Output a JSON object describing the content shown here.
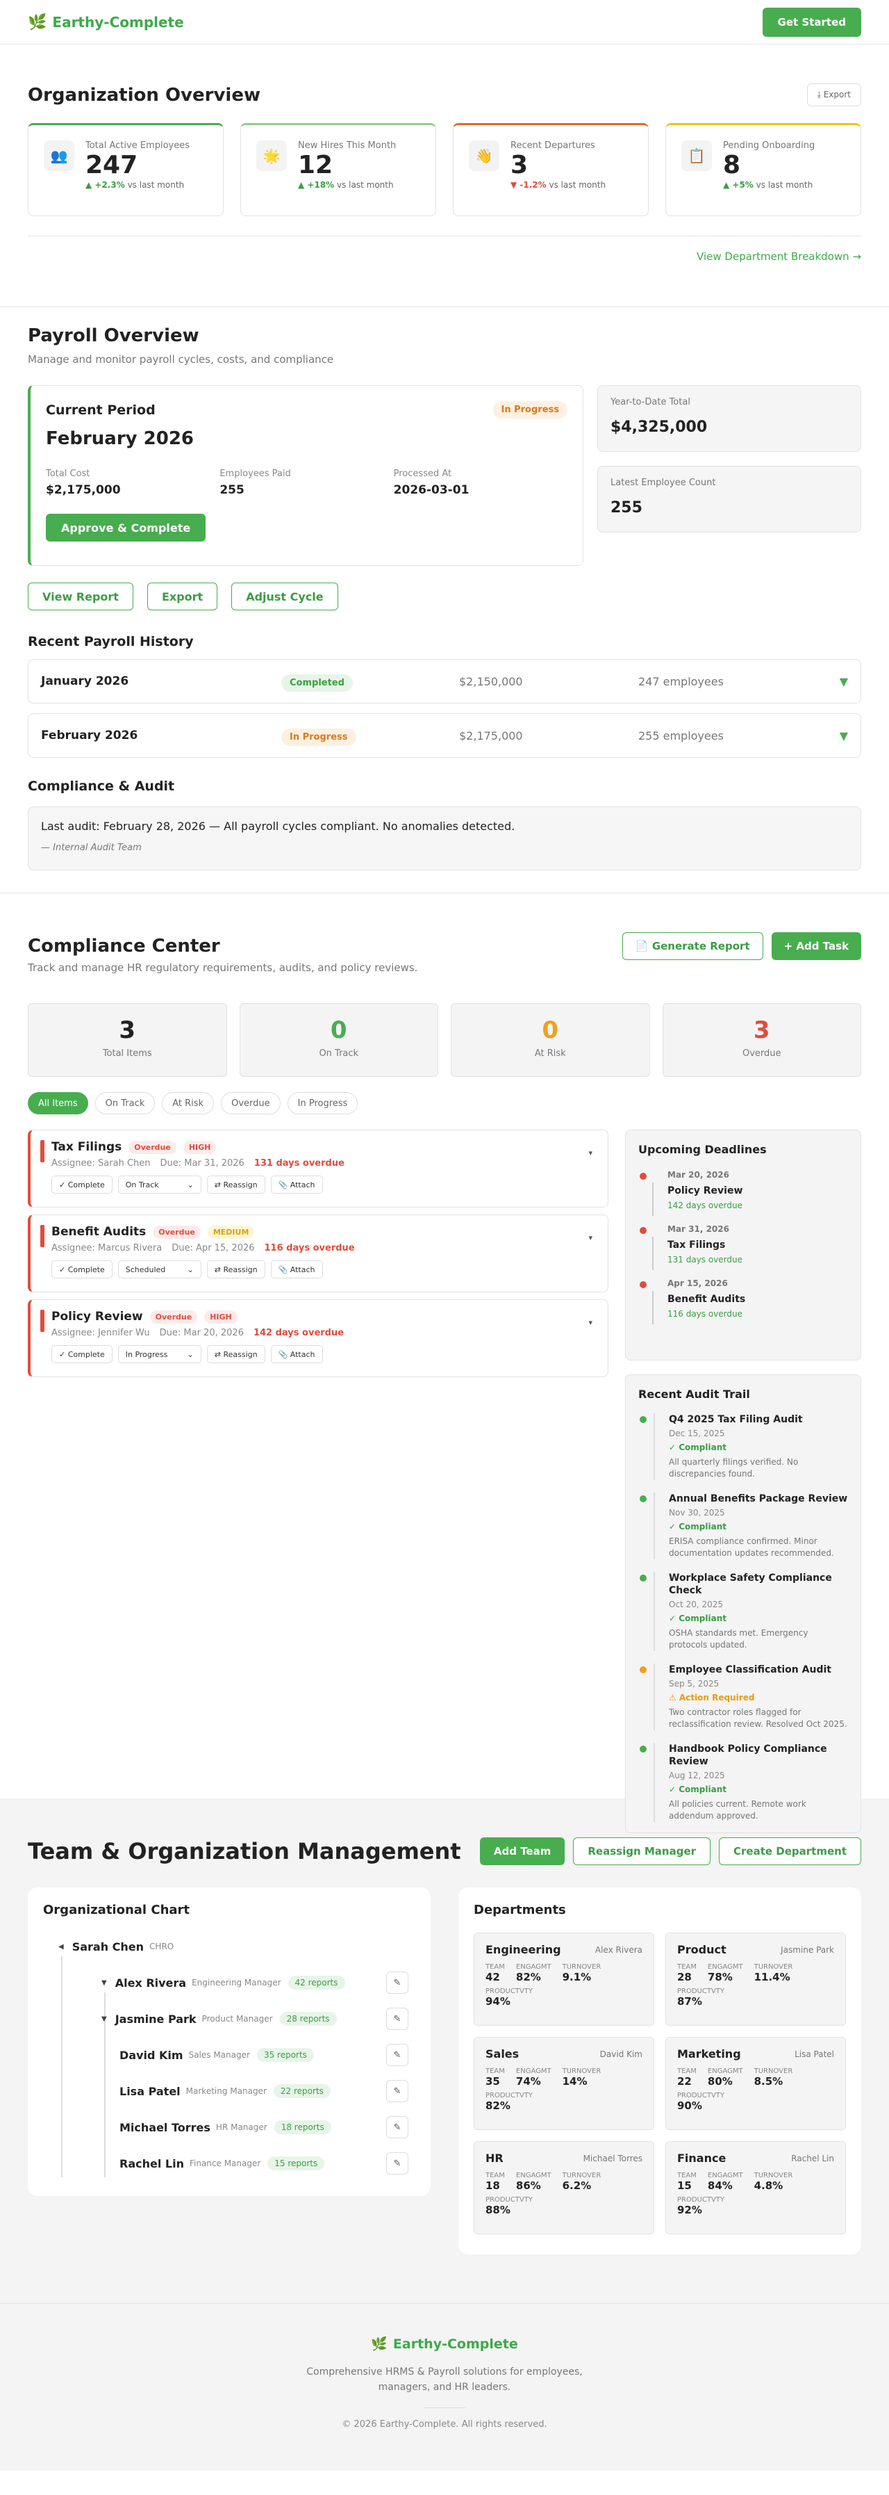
{
  "brand": {
    "name": "Earthy-Complete",
    "cta": "Get Started"
  },
  "org": {
    "title": "Organization Overview",
    "export": "Export",
    "link": "View Department Breakdown →",
    "stats": [
      {
        "label": "Total Active Employees",
        "value": "247",
        "change": "▲ +2.3%",
        "suffix": "vs last month",
        "dir": "up",
        "icon": "people-icon",
        "glyph": "👥",
        "accent": "#48ad4f"
      },
      {
        "label": "New Hires This Month",
        "value": "12",
        "change": "▲ +18%",
        "suffix": "vs last month",
        "dir": "up",
        "icon": "sparkle-icon",
        "glyph": "🌟",
        "accent": "#8fcf8f"
      },
      {
        "label": "Recent Departures",
        "value": "3",
        "change": "▼ -1.2%",
        "suffix": "vs last month",
        "dir": "down",
        "icon": "wave-icon",
        "glyph": "👋",
        "accent": "#e8672a"
      },
      {
        "label": "Pending Onboarding",
        "value": "8",
        "change": "▲ +5%",
        "suffix": "vs last month",
        "dir": "up",
        "icon": "clipboard-icon",
        "glyph": "📋",
        "accent": "#f2c418"
      }
    ]
  },
  "payroll": {
    "title": "Payroll Overview",
    "subtitle": "Manage and monitor payroll cycles, costs, and compliance",
    "current": {
      "heading": "Current Period",
      "status": "In Progress",
      "month": "February 2026",
      "cost_label": "Total Cost",
      "cost": "$2,175,000",
      "paid_label": "Employees Paid",
      "paid": "255",
      "proc_label": "Processed At",
      "proc": "2026-03-01",
      "approve": "Approve & Complete"
    },
    "ytd_label": "Year-to-Date Total",
    "ytd": "$4,325,000",
    "count_label": "Latest Employee Count",
    "count": "255",
    "buttons": {
      "report": "View Report",
      "export": "Export",
      "adjust": "Adjust Cycle"
    },
    "history_title": "Recent Payroll History",
    "history": [
      {
        "month": "January 2026",
        "status": "Completed",
        "amount": "$2,150,000",
        "employees": "247 employees"
      },
      {
        "month": "February 2026",
        "status": "In Progress",
        "amount": "$2,175,000",
        "employees": "255 employees"
      }
    ],
    "audit_title": "Compliance & Audit",
    "audit_text": "Last audit: February 28, 2026 — All payroll cycles compliant. No anomalies detected.",
    "audit_by": "— Internal Audit Team"
  },
  "compliance": {
    "title": "Compliance Center",
    "subtitle": "Track and manage HR regulatory requirements, audits, and policy reviews.",
    "gen_report": "Generate Report",
    "add_task": "+ Add Task",
    "stats": [
      {
        "value": "3",
        "label": "Total Items",
        "color": "#222222"
      },
      {
        "value": "0",
        "label": "On Track",
        "color": "#48ad4f"
      },
      {
        "value": "0",
        "label": "At Risk",
        "color": "#f0a020"
      },
      {
        "value": "3",
        "label": "Overdue",
        "color": "#e04c3c"
      }
    ],
    "filters": [
      "All Items",
      "On Track",
      "At Risk",
      "Overdue",
      "In Progress"
    ],
    "tasks": [
      {
        "name": "Tax Filings",
        "status": "Overdue",
        "priority": "HIGH",
        "pclass": "tag-hi",
        "assignee": "Assignee: Sarah Chen",
        "due": "Due: Mar 31, 2026",
        "late": "131 days overdue",
        "select": "On Track"
      },
      {
        "name": "Benefit Audits",
        "status": "Overdue",
        "priority": "MEDIUM",
        "pclass": "tag-md",
        "assignee": "Assignee: Marcus Rivera",
        "due": "Due: Apr 15, 2026",
        "late": "116 days overdue",
        "select": "Scheduled"
      },
      {
        "name": "Policy Review",
        "status": "Overdue",
        "priority": "HIGH",
        "pclass": "tag-hi",
        "assignee": "Assignee: Jennifer Wu",
        "due": "Due: Mar 20, 2026",
        "late": "142 days overdue",
        "select": "In Progress"
      }
    ],
    "task_actions": {
      "complete": "✓ Complete",
      "reassign": "⇄ Reassign",
      "attach": "📎 Attach"
    },
    "deadlines_title": "Upcoming Deadlines",
    "deadlines": [
      {
        "date": "Mar 20, 2026",
        "name": "Policy Review",
        "overdue": "142 days overdue"
      },
      {
        "date": "Mar 31, 2026",
        "name": "Tax Filings",
        "overdue": "131 days overdue"
      },
      {
        "date": "Apr 15, 2026",
        "name": "Benefit Audits",
        "overdue": "116 days overdue"
      }
    ],
    "trail_title": "Recent Audit Trail",
    "trail": [
      {
        "name": "Q4 2025 Tax Filing Audit",
        "date": "Dec 15, 2025",
        "status": "✓ Compliant",
        "kind": "ok",
        "note": "All quarterly filings verified. No discrepancies found."
      },
      {
        "name": "Annual Benefits Package Review",
        "date": "Nov 30, 2025",
        "status": "✓ Compliant",
        "kind": "ok",
        "note": "ERISA compliance confirmed. Minor documentation updates recommended."
      },
      {
        "name": "Workplace Safety Compliance Check",
        "date": "Oct 20, 2025",
        "status": "✓ Compliant",
        "kind": "ok",
        "note": "OSHA standards met. Emergency protocols updated."
      },
      {
        "name": "Employee Classification Audit",
        "date": "Sep 5, 2025",
        "status": "⚠ Action Required",
        "kind": "am",
        "note": "Two contractor roles flagged for reclassification review. Resolved Oct 2025."
      },
      {
        "name": "Handbook Policy Compliance Review",
        "date": "Aug 12, 2025",
        "status": "✓ Compliant",
        "kind": "ok",
        "note": "All policies current. Remote work addendum approved."
      }
    ]
  },
  "team": {
    "title": "Team & Organization Management",
    "add_team": "Add Team",
    "reassign": "Reassign Manager",
    "create_dept": "Create Department",
    "chart_title": "Organizational Chart",
    "root": {
      "name": "Sarah Chen",
      "role": "CHRO"
    },
    "managers": [
      {
        "name": "Alex Rivera",
        "role": "Engineering Manager",
        "reports": "42 reports"
      },
      {
        "name": "Jasmine Park",
        "role": "Product Manager",
        "reports": "28 reports"
      },
      {
        "name": "David Kim",
        "role": "Sales Manager",
        "reports": "35 reports"
      },
      {
        "name": "Lisa Patel",
        "role": "Marketing Manager",
        "reports": "22 reports"
      },
      {
        "name": "Michael Torres",
        "role": "HR Manager",
        "reports": "18 reports"
      },
      {
        "name": "Rachel Lin",
        "role": "Finance Manager",
        "reports": "15 reports"
      }
    ],
    "deps_title": "Departments",
    "metric_labels": {
      "team": "TEAM",
      "eng": "ENGAGMT",
      "turn": "TURNOVER",
      "prod": "PRODUCTVTY"
    },
    "departments": [
      {
        "name": "Engineering",
        "mgr": "Alex Rivera",
        "team": "42",
        "eng": "82%",
        "turn": "9.1%",
        "prod": "94%"
      },
      {
        "name": "Product",
        "mgr": "Jasmine Park",
        "team": "28",
        "eng": "78%",
        "turn": "11.4%",
        "prod": "87%"
      },
      {
        "name": "Sales",
        "mgr": "David Kim",
        "team": "35",
        "eng": "74%",
        "turn": "14%",
        "prod": "82%"
      },
      {
        "name": "Marketing",
        "mgr": "Lisa Patel",
        "team": "22",
        "eng": "80%",
        "turn": "8.5%",
        "prod": "90%"
      },
      {
        "name": "HR",
        "mgr": "Michael Torres",
        "team": "18",
        "eng": "86%",
        "turn": "6.2%",
        "prod": "88%"
      },
      {
        "name": "Finance",
        "mgr": "Rachel Lin",
        "team": "15",
        "eng": "84%",
        "turn": "4.8%",
        "prod": "92%"
      }
    ]
  },
  "footer": {
    "desc1": "Comprehensive HRMS & Payroll solutions for employees,",
    "desc2": "managers, and HR leaders.",
    "copyright": "© 2026 Earthy-Complete. All rights reserved."
  }
}
